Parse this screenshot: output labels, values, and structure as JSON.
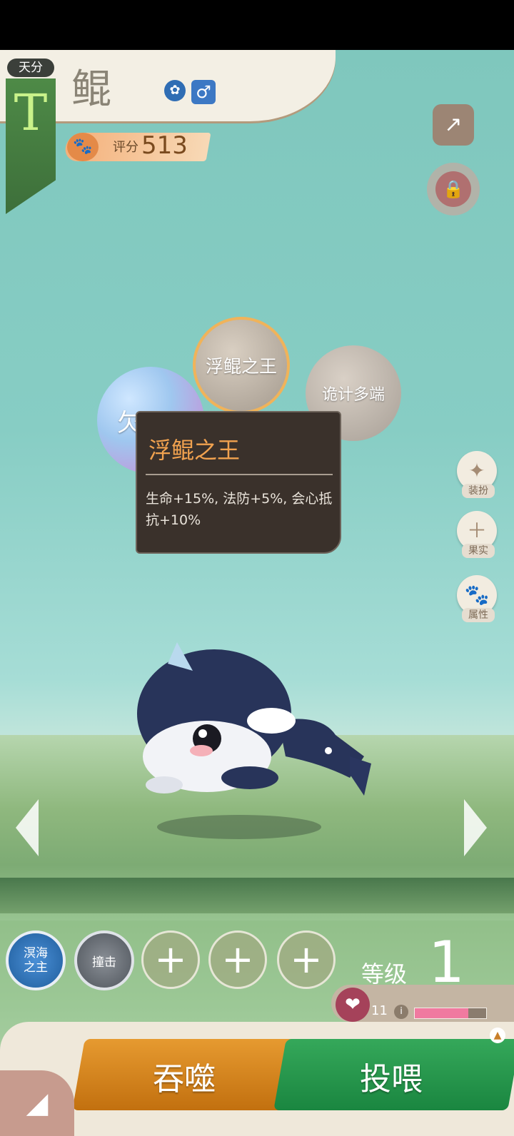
{
  "header": {
    "tier_label": "天分",
    "tier_grade": "T",
    "pet_name": "鲲",
    "gender_symbol": "♂",
    "score_label": "评分",
    "score_value": "513"
  },
  "traits": {
    "main": "浮鲲之王",
    "right": "诡计多端",
    "left_partial": "欠"
  },
  "tooltip": {
    "title": "浮鲲之王",
    "body": "生命+15%, 法防+5%, 会心抵抗+10%"
  },
  "side_menu": {
    "dress": "装扮",
    "fruit": "果实",
    "attributes": "属性"
  },
  "skills": [
    {
      "label": "溟海之主"
    },
    {
      "label": "撞击"
    }
  ],
  "level": {
    "label": "等级",
    "value": "1"
  },
  "affection": {
    "count": "11",
    "fill_fraction": 0.75,
    "color": "#f07aa0"
  },
  "actions": {
    "devour": "吞噬",
    "feed": "投喂"
  },
  "colors": {
    "devour": "#d98520",
    "feed": "#2a9a4c",
    "tooltip_title": "#f1a24f"
  }
}
